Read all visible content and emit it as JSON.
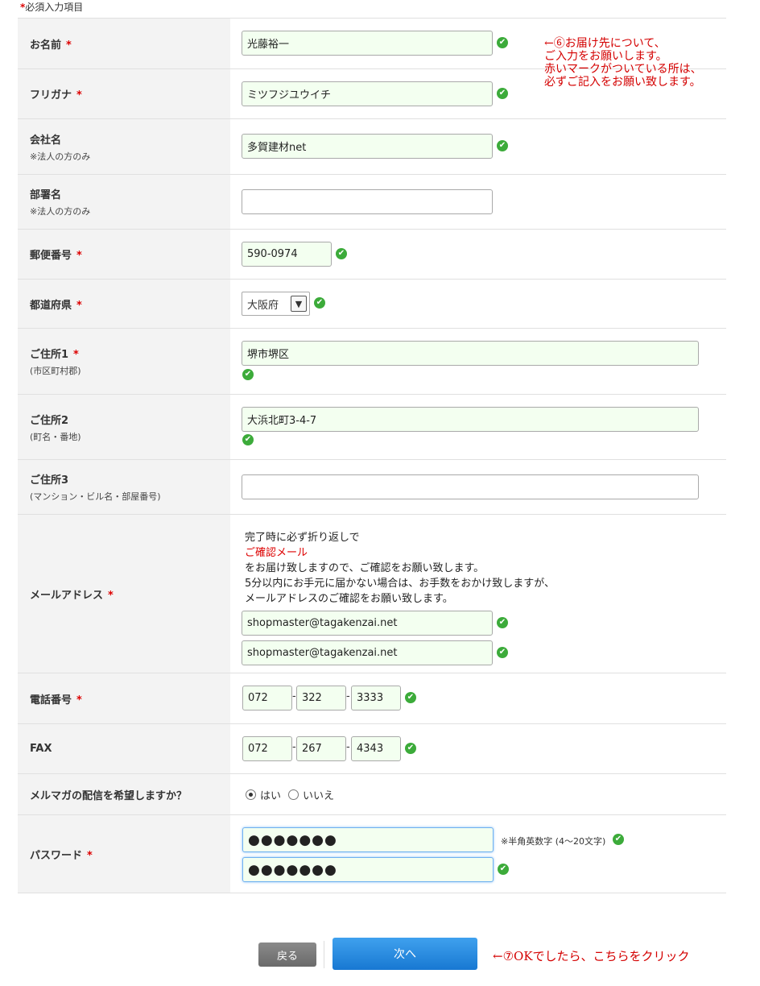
{
  "required_note": {
    "star": "*",
    "text": "必須入力項目"
  },
  "required_mark": "*",
  "check_mark": "✔",
  "fields": {
    "name": {
      "label": "お名前",
      "value": "光藤裕一"
    },
    "furigana": {
      "label": "フリガナ",
      "value": "ミツフジユウイチ"
    },
    "company": {
      "label": "会社名",
      "sub": "※法人の方のみ",
      "value": "多賀建材net"
    },
    "department": {
      "label": "部署名",
      "sub": "※法人の方のみ",
      "value": ""
    },
    "postal": {
      "label": "郵便番号",
      "value": "590-0974"
    },
    "prefecture": {
      "label": "都道府県",
      "value": "大阪府"
    },
    "address1": {
      "label": "ご住所1",
      "sub": "(市区町村郡)",
      "value": "堺市堺区"
    },
    "address2": {
      "label": "ご住所2",
      "sub": "(町名・番地)",
      "value": "大浜北町3-4-7"
    },
    "address3": {
      "label": "ご住所3",
      "sub": "(マンション・ビル名・部屋番号)",
      "value": ""
    },
    "email": {
      "label": "メールアドレス",
      "note_line1": "完了時に必ず折り返しで",
      "note_red": "ご確認メール",
      "note_line2": "をお届け致しますので、ご確認をお願い致します。",
      "note_line3": "5分以内にお手元に届かない場合は、お手数をおかけ致しますが、",
      "note_line4": "メールアドレスのご確認をお願い致します。",
      "value": "shopmaster@tagakenzai.net",
      "confirm_value": "shopmaster@tagakenzai.net"
    },
    "phone": {
      "label": "電話番号",
      "part1": "072",
      "part2": "322",
      "part3": "3333",
      "separator": "-"
    },
    "fax": {
      "label": "FAX",
      "part1": "072",
      "part2": "267",
      "part3": "4343",
      "separator": "-"
    },
    "newsletter": {
      "label": "メルマガの配信を希望しますか？",
      "yes": "はい",
      "no": "いいえ",
      "selected": "はい"
    },
    "password": {
      "label": "パスワード",
      "masked": "●●●●●●●",
      "confirm_masked": "●●●●●●●",
      "note": "※半角英数字 (4～20文字)"
    }
  },
  "buttons": {
    "back": "戻る",
    "next": "次へ"
  },
  "annotations": {
    "top_line1": "←⑥お届け先について、",
    "top_line2": "ご入力をお願いします。",
    "top_line3": "赤いマークがついている所は、",
    "top_line4": "必ずご記入をお願い致します。",
    "bottom": "←⑦OKでしたら、こちらをクリック"
  },
  "colors": {
    "required": "#dd0000",
    "valid_bg": "#f3fff0",
    "check": "#3cab3a",
    "next_button": "#2d8fe4",
    "back_button": "#7a7a7a",
    "annotation": "#d40000"
  }
}
